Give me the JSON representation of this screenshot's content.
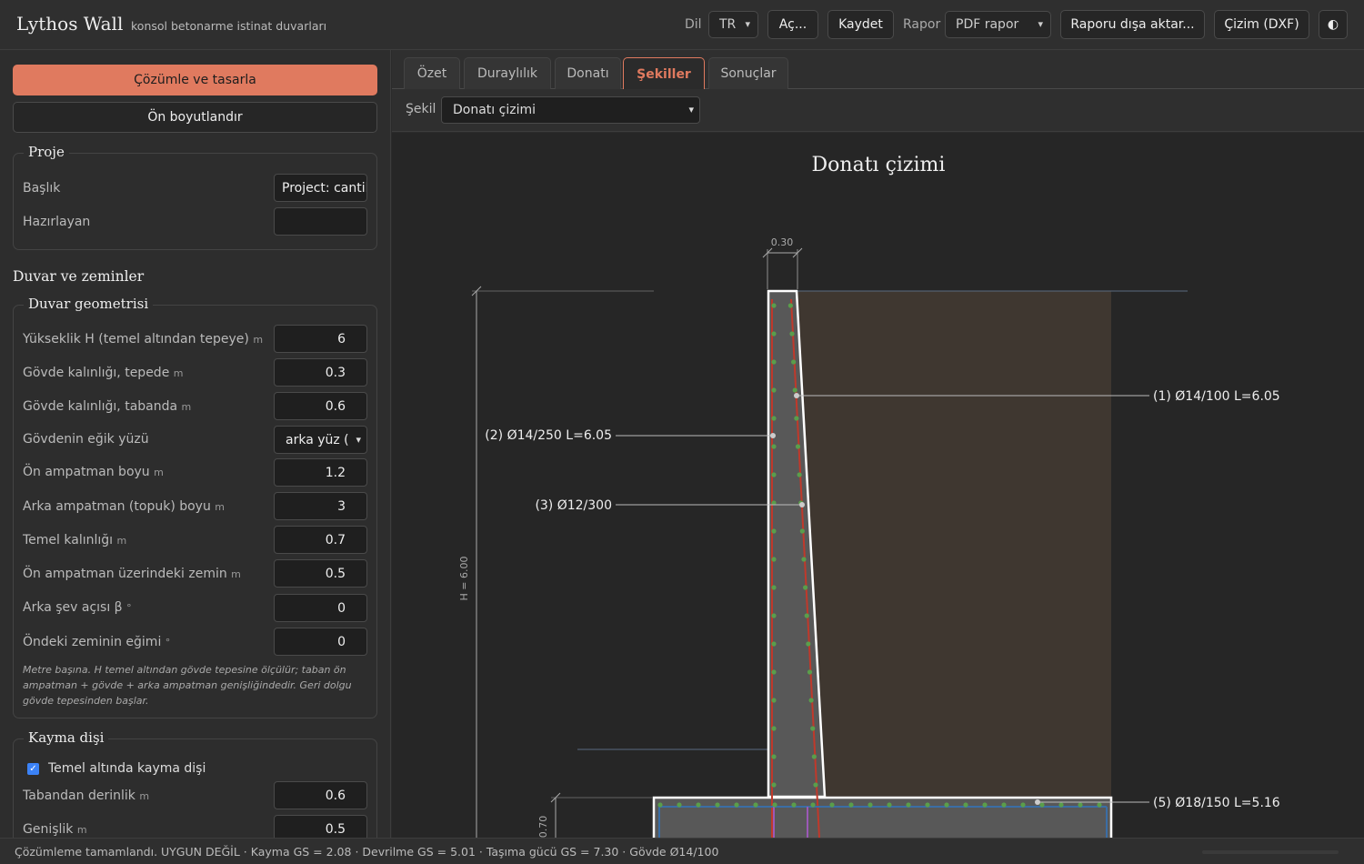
{
  "app": {
    "title": "Lythos Wall",
    "subtitle": "konsol betonarme istinat duvarları"
  },
  "topbar": {
    "lang_label": "Dil",
    "lang_value": "TR",
    "open_label": "Aç...",
    "save_label": "Kaydet",
    "report_label": "Rapor",
    "report_value": "PDF rapor",
    "export_report_label": "Raporu dışa aktar...",
    "drawing_label": "Çizim (DXF)",
    "theme_icon": "◐"
  },
  "sidebar": {
    "solve_label": "Çözümle ve tasarla",
    "presize_label": "Ön boyutlandır",
    "project": {
      "legend": "Proje",
      "title_label": "Başlık",
      "title_value": "Project: cantilever",
      "author_label": "Hazırlayan",
      "author_value": ""
    },
    "section_title": "Duvar ve zeminler",
    "geometry": {
      "legend": "Duvar geometrisi",
      "rows": [
        {
          "label": "Yükseklik H (temel altından tepeye)",
          "unit": "m",
          "value": "6"
        },
        {
          "label": "Gövde kalınlığı, tepede",
          "unit": "m",
          "value": "0.3"
        },
        {
          "label": "Gövde kalınlığı, tabanda",
          "unit": "m",
          "value": "0.6"
        },
        {
          "label": "Gövdenin eğik yüzü",
          "unit": "",
          "value": "arka yüz ("
        },
        {
          "label": "Ön ampatman boyu",
          "unit": "m",
          "value": "1.2"
        },
        {
          "label": "Arka ampatman (topuk) boyu",
          "unit": "m",
          "value": "3"
        },
        {
          "label": "Temel kalınlığı",
          "unit": "m",
          "value": "0.7"
        },
        {
          "label": "Ön ampatman üzerindeki zemin",
          "unit": "m",
          "value": "0.5"
        },
        {
          "label": "Arka şev açısı β",
          "unit": "°",
          "value": "0"
        },
        {
          "label": "Öndeki zeminin eğimi",
          "unit": "°",
          "value": "0"
        }
      ],
      "note": "Metre başına. H temel altından gövde tepesine ölçülür; taban ön ampatman + gövde + arka ampatman genişliğindedir. Geri dolgu gövde tepesinden başlar."
    },
    "shear_key": {
      "legend": "Kayma dişi",
      "checkbox_label": "Temel altında kayma dişi",
      "checked": true,
      "rows": [
        {
          "label": "Tabandan derinlik",
          "unit": "m",
          "value": "0.6"
        },
        {
          "label": "Genişlik",
          "unit": "m",
          "value": "0.5"
        }
      ]
    }
  },
  "tabs": [
    {
      "label": "Özet",
      "active": false
    },
    {
      "label": "Duraylılık",
      "active": false
    },
    {
      "label": "Donatı",
      "active": false
    },
    {
      "label": "Şekiller",
      "active": true
    },
    {
      "label": "Sonuçlar",
      "active": false
    }
  ],
  "figure": {
    "select_label": "Şekil",
    "select_value": "Donatı çizimi",
    "title": "Donatı çizimi",
    "dim_top": "0.30",
    "dim_height": "H = 6.00",
    "dim_footing": "0.70",
    "callouts": {
      "bar1": "(1) Ø14/100  L=6.05",
      "bar2": "(2) Ø14/250  L=6.05",
      "bar3": "(3) Ø12/300",
      "bar5": "(5) Ø18/150  L=5.16"
    }
  },
  "status": {
    "text": "Çözümleme tamamlandı. UYGUN DEĞİL · Kayma GS = 2.08 · Devrilme GS = 5.01 · Taşıma gücü GS = 7.30 · Gövde Ø14/100"
  },
  "colors": {
    "accent": "#e07a5f",
    "concrete": "#585858",
    "backfill": "#3f3730",
    "tension_bar": "#c0392b",
    "distribution_bar": "#5a9e4b",
    "footing_bar": "#3b6ea5",
    "key_bar": "#9b59b6"
  }
}
